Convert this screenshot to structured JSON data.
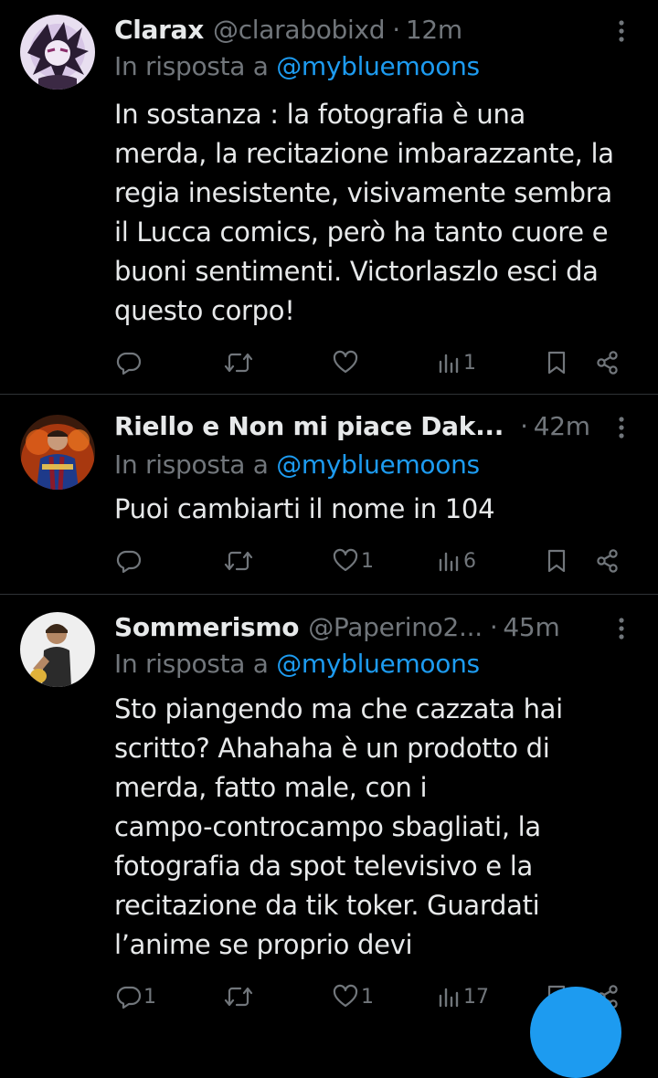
{
  "tweets": [
    {
      "name": "Clarax",
      "handle": "@clarabobixd",
      "separator": "·",
      "time": "12m",
      "reply_prefix": "In risposta a",
      "reply_mention": "@mybluemoons",
      "text": "In sostanza : la fotografia è una\nmerda, la recitazione imbarazzante, la\nregia inesistente, visivamente sembra\nil Lucca comics, però ha tanto cuore e\nbuoni sentimenti. Victorlaszlo esci da\nquesto corpo!",
      "replies": "",
      "retweets": "",
      "likes": "",
      "views": "1"
    },
    {
      "name": "Riello e Non mi piace Dak...",
      "handle": "",
      "separator": "·",
      "time": "42m",
      "reply_prefix": "In risposta a",
      "reply_mention": "@mybluemoons",
      "text": "Puoi cambiarti il nome in 104",
      "replies": "",
      "retweets": "",
      "likes": "1",
      "views": "6"
    },
    {
      "name": "Sommerismo",
      "handle": "@Paperino2...",
      "separator": "·",
      "time": "45m",
      "reply_prefix": "In risposta a",
      "reply_mention": "@mybluemoons",
      "text": "Sto piangendo ma che cazzata hai\nscritto? Ahahaha è un prodotto di\nmerda, fatto male, con i\ncampo-controcampo sbagliati, la\nfotografia da spot televisivo e la\nrecitazione da tik toker. Guardati\nl’anime se proprio devi",
      "replies": "1",
      "retweets": "",
      "likes": "1",
      "views": "17"
    }
  ],
  "icons": {
    "reply": "reply-icon",
    "retweet": "retweet-icon",
    "like": "heart-icon",
    "views": "views-icon",
    "bookmark": "bookmark-icon",
    "share": "share-icon",
    "more": "more-options-icon",
    "compose": "compose-button"
  },
  "colors": {
    "background": "#000000",
    "text": "#e7e9ea",
    "secondary": "#71767b",
    "accent": "#1d9bf0",
    "divider": "#2f3336"
  }
}
